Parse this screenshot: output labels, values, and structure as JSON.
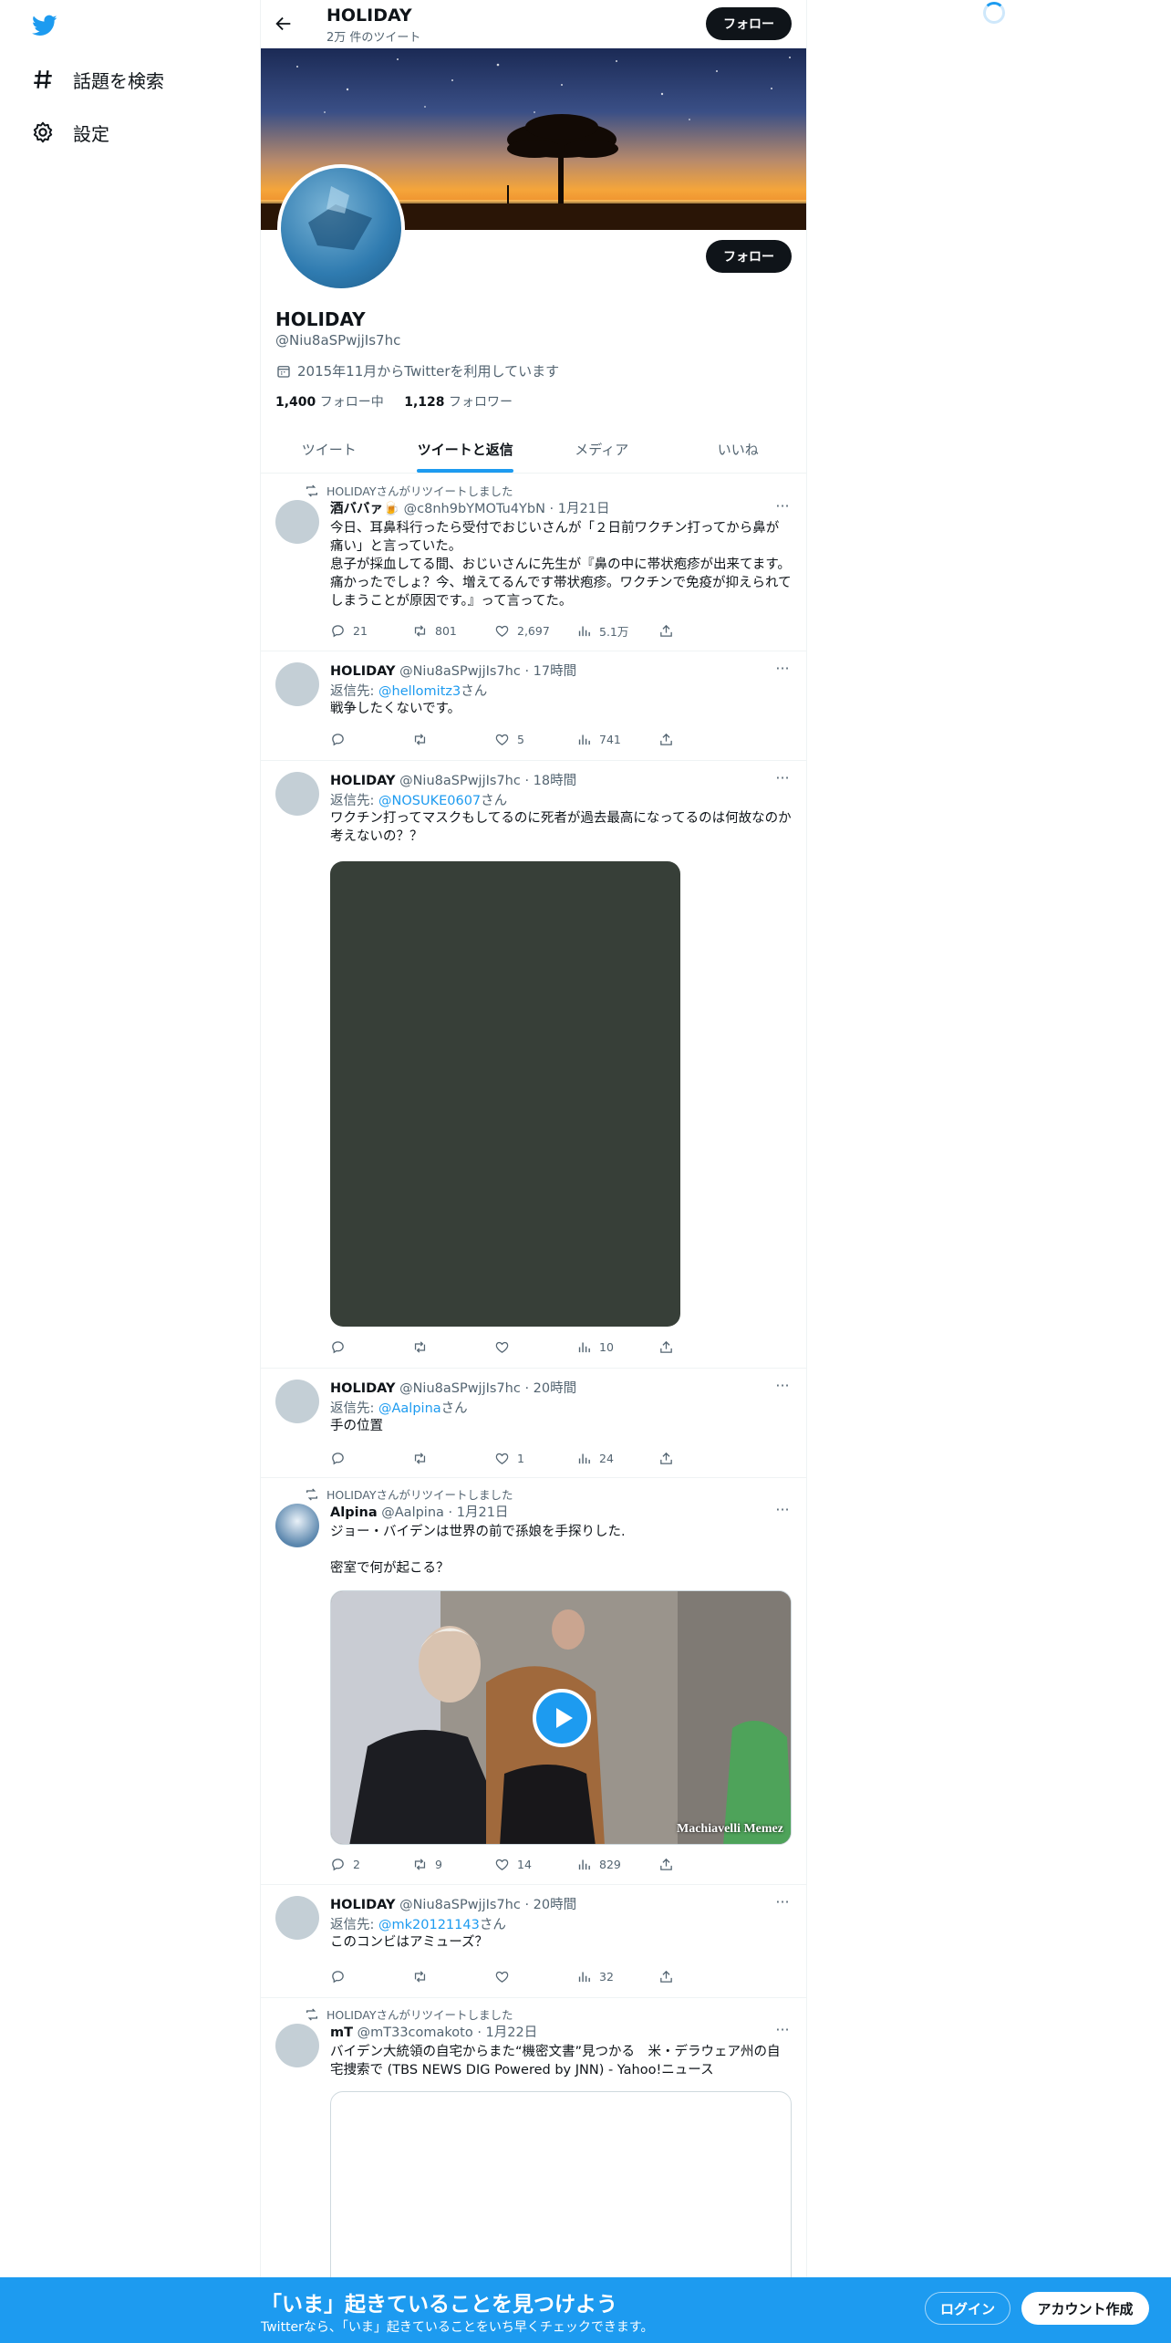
{
  "nav": {
    "explore_label": "話題を検索",
    "settings_label": "設定"
  },
  "header": {
    "title": "HOLIDAY",
    "subtitle": "2万 件のツイート",
    "follow_label": "フォロー"
  },
  "profile": {
    "name": "HOLIDAY",
    "handle": "@Niu8aSPwjjIs7hc",
    "joined": "2015年11月からTwitterを利用しています",
    "following_count": "1,400",
    "following_label": "フォロー中",
    "followers_count": "1,128",
    "followers_label": "フォロワー",
    "follow_label": "フォロー"
  },
  "tabs": [
    {
      "label": "ツイート"
    },
    {
      "label": "ツイートと返信"
    },
    {
      "label": "メディア"
    },
    {
      "label": "いいね"
    }
  ],
  "tweets": [
    {
      "retweet_line": "HOLIDAYさんがリツイートしました",
      "name": "酒ババァ",
      "name_emoji": "🍺",
      "handle": "@c8nh9bYMOTu4YbN",
      "time": "1月21日",
      "text": "今日、耳鼻科行ったら受付でおじいさんが「２日前ワクチン打ってから鼻が痛い」と言っていた。\n息子が採血してる間、おじいさんに先生が『鼻の中に帯状疱疹が出来てます。痛かったでしょ？今、増えてるんです帯状疱疹。ワクチンで免疫が抑えられてしまうことが原因です。』って言ってた。",
      "reply": "21",
      "retweet": "801",
      "like": "2,697",
      "views": "5.1万"
    },
    {
      "name": "HOLIDAY",
      "handle": "@Niu8aSPwjjIs7hc",
      "time": "17時間",
      "reply_prefix": "返信先: ",
      "reply_to": "@hellomitz3",
      "reply_suffix": "さん",
      "text": "戦争したくないです。",
      "reply": "",
      "retweet": "",
      "like": "5",
      "views": "741"
    },
    {
      "name": "HOLIDAY",
      "handle": "@Niu8aSPwjjIs7hc",
      "time": "18時間",
      "reply_prefix": "返信先: ",
      "reply_to": "@NOSUKE0607",
      "reply_suffix": "さん",
      "text": "ワクチン打ってマスクもしてるのに死者が過去最高になってるのは何故なのか考えないの？？",
      "reply": "",
      "retweet": "",
      "like": "",
      "views": "10"
    },
    {
      "name": "HOLIDAY",
      "handle": "@Niu8aSPwjjIs7hc",
      "time": "20時間",
      "reply_prefix": "返信先: ",
      "reply_to": "@Aalpina",
      "reply_suffix": "さん",
      "text": "手の位置",
      "reply": "",
      "retweet": "",
      "like": "1",
      "views": "24"
    },
    {
      "retweet_line": "HOLIDAYさんがリツイートしました",
      "name": "Alpina",
      "handle": "@Aalpina",
      "time": "1月21日",
      "text": "ジョー・バイデンは世界の前で孫娘を手探りした.\n\n密室で何が起こる？",
      "video_watermark": "Machiavelli Memez",
      "reply": "2",
      "retweet": "9",
      "like": "14",
      "views": "829"
    },
    {
      "name": "HOLIDAY",
      "handle": "@Niu8aSPwjjIs7hc",
      "time": "20時間",
      "reply_prefix": "返信先: ",
      "reply_to": "@mk20121143",
      "reply_suffix": "さん",
      "text": "このコンビはアミューズ？",
      "reply": "",
      "retweet": "",
      "like": "",
      "views": "32"
    },
    {
      "retweet_line": "HOLIDAYさんがリツイートしました",
      "name": "mT",
      "handle": "@mT33comakoto",
      "time": "1月22日",
      "text": "バイデン大統領の自宅からまた“機密文書”見つかる　米・デラウェア州の自宅捜索で (TBS NEWS DIG Powered by JNN) - Yahoo!ニュース"
    }
  ],
  "time_sep": " · ",
  "bottom_bar": {
    "title": "「いま」起きていることを見つけよう",
    "subtitle": "Twitterなら、「いま」起きていることをいち早くチェックできます。",
    "login_label": "ログイン",
    "signup_label": "アカウント作成"
  },
  "colors": {
    "accent": "#1d9bf0",
    "bottom_bar": "#1d9bf0",
    "media_placeholder": "#373f38"
  }
}
